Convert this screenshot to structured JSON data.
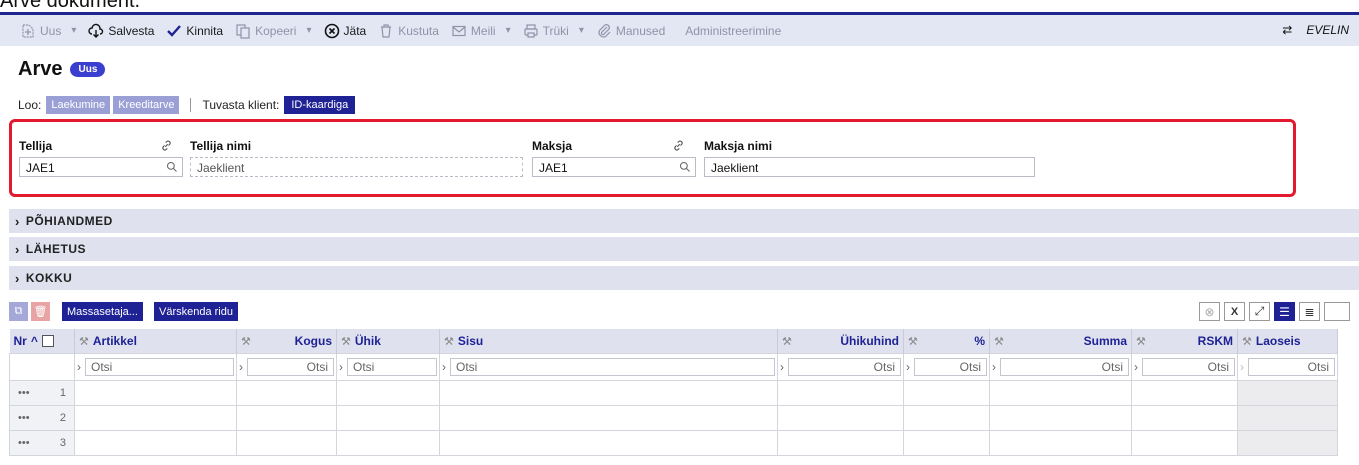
{
  "document": {
    "heading": "Arve dokument."
  },
  "toolbar": {
    "buttons": [
      {
        "label": "Uus",
        "icon": "new-doc-icon",
        "disabled": true,
        "dropdown": true
      },
      {
        "label": "Salvesta",
        "icon": "save-cloud-icon",
        "disabled": false
      },
      {
        "label": "Kinnita",
        "icon": "check-icon",
        "disabled": false
      },
      {
        "label": "Kopeeri",
        "icon": "copy-icon",
        "disabled": true,
        "dropdown": true
      },
      {
        "label": "Jäta",
        "icon": "cancel-circle-icon",
        "disabled": false
      },
      {
        "label": "Kustuta",
        "icon": "trash-icon",
        "disabled": true
      },
      {
        "label": "Meili",
        "icon": "mail-icon",
        "disabled": true,
        "dropdown": true
      },
      {
        "label": "Trüki",
        "icon": "print-icon",
        "disabled": true,
        "dropdown": true
      },
      {
        "label": "Manused",
        "icon": "paperclip-icon",
        "disabled": true
      },
      {
        "label": "Administreerimine",
        "icon": "",
        "disabled": true
      }
    ],
    "user": "EVELIN"
  },
  "header": {
    "title": "Arve",
    "status": "Uus"
  },
  "create": {
    "label": "Loo:",
    "options": [
      "Laekumine",
      "Kreeditarve"
    ],
    "verify_label": "Tuvasta klient:",
    "verify_button": "ID-kaardiga"
  },
  "parties": {
    "tellija_label": "Tellija",
    "tellija_value": "JAE1",
    "tellija_nimi_label": "Tellija nimi",
    "tellija_nimi_value": "Jaeklient",
    "maksja_label": "Maksja",
    "maksja_value": "JAE1",
    "maksja_nimi_label": "Maksja nimi",
    "maksja_nimi_value": "Jaeklient"
  },
  "sections": [
    "PÕHIANDMED",
    "LÄHETUS",
    "KOKKU"
  ],
  "grid_toolbar": {
    "mass_button": "Massasetaja...",
    "refresh_button": "Värskenda ridu"
  },
  "grid": {
    "columns": [
      "Nr",
      "Artikkel",
      "Kogus",
      "Ühik",
      "Sisu",
      "Ühikuhind",
      "%",
      "Summa",
      "RSKM",
      "Laoseis"
    ],
    "filter_placeholder": "Otsi",
    "rows": [
      {
        "nr": "1"
      },
      {
        "nr": "2"
      },
      {
        "nr": "3"
      }
    ]
  },
  "colors": {
    "accent": "#1e2295",
    "highlight_border": "#e3192f",
    "toolbar_bg": "#e3e7f4"
  }
}
